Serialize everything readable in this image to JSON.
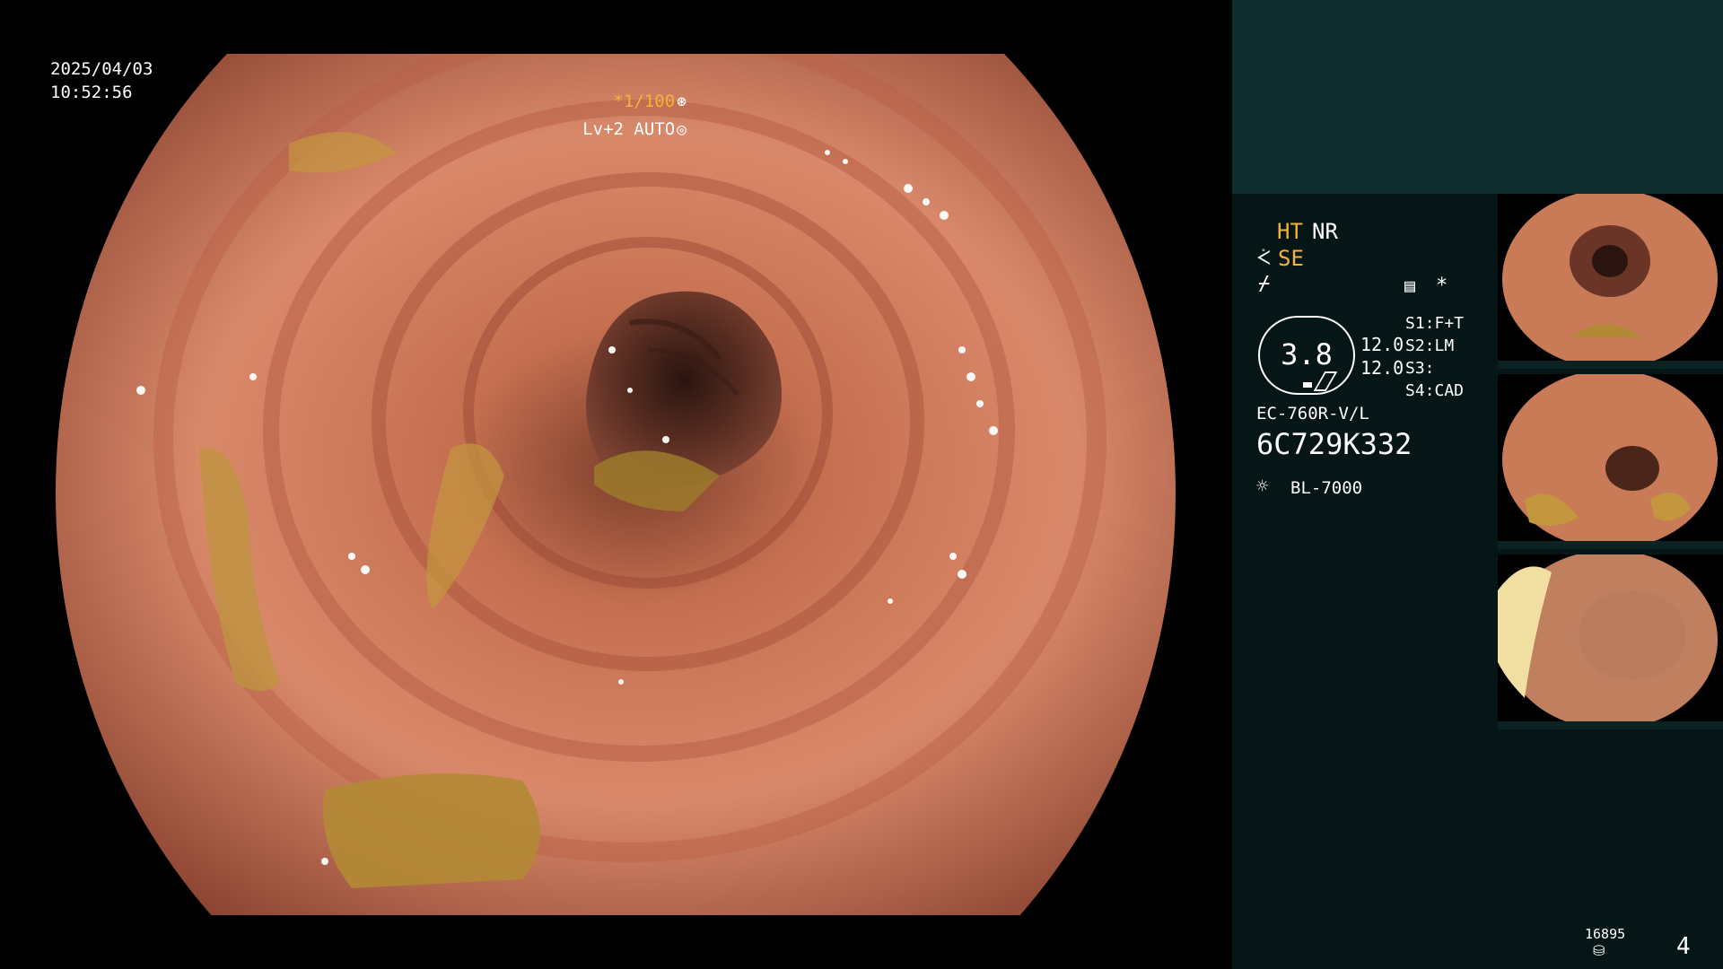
{
  "screen": {
    "date": "2025/04/03",
    "time": "10:52:56",
    "shutter": "*1/100",
    "level": "Lv+2 AUTO"
  },
  "panel": {
    "modes": {
      "ht": "HT",
      "nr": "NR",
      "se": "SE"
    },
    "icons": [
      "scope-icon",
      "flash-icon",
      "settings-icon",
      "asterisk-icon",
      "lamp-icon",
      "storage-icon"
    ],
    "gauge_value": "3.8",
    "readings": [
      "12.0",
      "12.0"
    ],
    "switches": [
      "S1:F+T",
      "S2:LM",
      "S3:",
      "S4:CAD"
    ],
    "scope_model": "EC-760R-V/L",
    "serial": "6C729K332",
    "light_source": "BL-7000",
    "storage_count": "16895",
    "capture_count": "4"
  },
  "colors": {
    "highlight": "#f4b23c",
    "panel_bg": "#061515",
    "panel_top_bg": "#0f2f2f"
  }
}
